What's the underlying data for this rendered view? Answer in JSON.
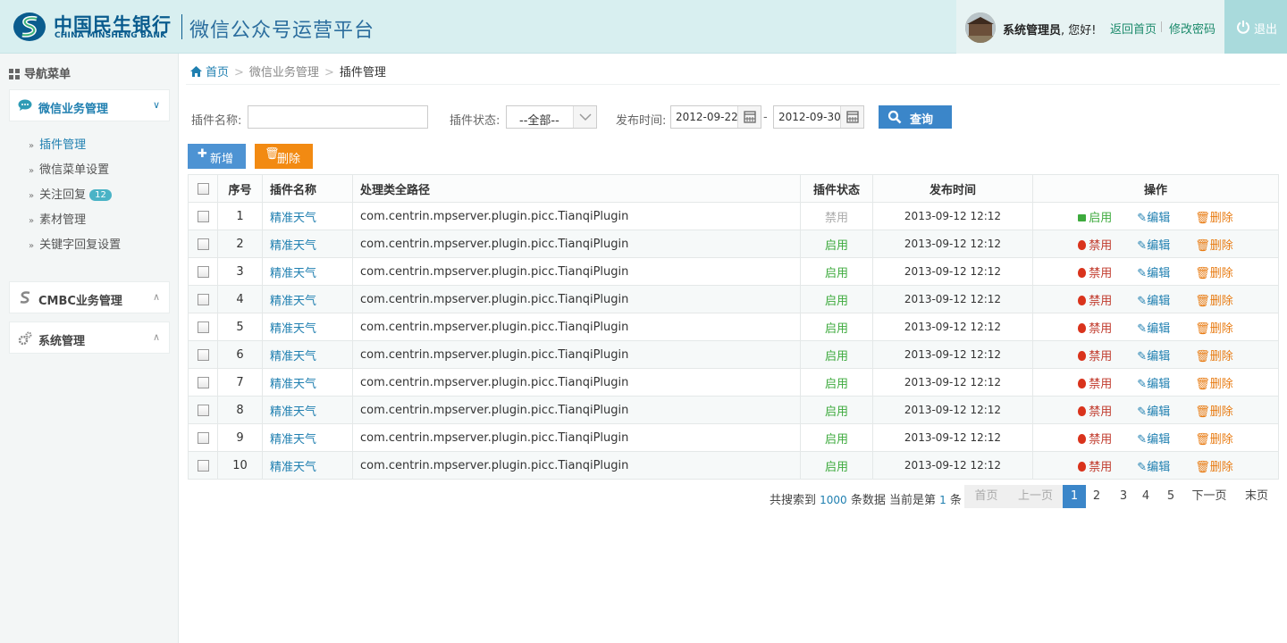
{
  "header": {
    "bank_name_cn": "中国民生银行",
    "bank_name_en": "CHINA MINSHENG BANK",
    "platform_title": "微信公众号运营平台",
    "user_role": "系统管理员",
    "greeting_suffix": ", 您好!",
    "home_link": "返回首页",
    "change_password": "修改密码",
    "logout": "退出",
    "brand_color": "#0a5c8e"
  },
  "sidebar": {
    "title": "导航菜单",
    "groups": [
      {
        "label": "微信业务管理",
        "expanded": true,
        "items": [
          {
            "label": "插件管理",
            "active": true
          },
          {
            "label": "微信菜单设置"
          },
          {
            "label": "关注回复",
            "badge": "12"
          },
          {
            "label": "素材管理"
          },
          {
            "label": "关键字回复设置"
          }
        ]
      },
      {
        "label": "CMBC业务管理",
        "expanded": false
      },
      {
        "label": "系统管理",
        "expanded": false
      }
    ]
  },
  "breadcrumb": {
    "home": "首页",
    "section": "微信业务管理",
    "current": "插件管理"
  },
  "filters": {
    "name_label": "插件名称:",
    "name_value": "",
    "status_label": "插件状态:",
    "status_value": "--全部--",
    "date_label": "发布时间:",
    "date_from": "2012-09-22",
    "date_to": "2012-09-30",
    "date_sep": "-",
    "query": "查询"
  },
  "toolbar": {
    "add": "新增",
    "delete": "删除"
  },
  "table": {
    "headers": [
      "",
      "序号",
      "插件名称",
      "处理类全路径",
      "插件状态",
      "发布时间",
      "操作"
    ],
    "rows": [
      {
        "no": "1",
        "name": "精准天气",
        "path": "com.centrin.mpserver.plugin.picc.TianqiPlugin",
        "status": "禁用",
        "time": "2013-09-12 12:12",
        "toggle": "启用"
      },
      {
        "no": "2",
        "name": "精准天气",
        "path": "com.centrin.mpserver.plugin.picc.TianqiPlugin",
        "status": "启用",
        "time": "2013-09-12 12:12",
        "toggle": "禁用"
      },
      {
        "no": "3",
        "name": "精准天气",
        "path": "com.centrin.mpserver.plugin.picc.TianqiPlugin",
        "status": "启用",
        "time": "2013-09-12 12:12",
        "toggle": "禁用"
      },
      {
        "no": "4",
        "name": "精准天气",
        "path": "com.centrin.mpserver.plugin.picc.TianqiPlugin",
        "status": "启用",
        "time": "2013-09-12 12:12",
        "toggle": "禁用"
      },
      {
        "no": "5",
        "name": "精准天气",
        "path": "com.centrin.mpserver.plugin.picc.TianqiPlugin",
        "status": "启用",
        "time": "2013-09-12 12:12",
        "toggle": "禁用"
      },
      {
        "no": "6",
        "name": "精准天气",
        "path": "com.centrin.mpserver.plugin.picc.TianqiPlugin",
        "status": "启用",
        "time": "2013-09-12 12:12",
        "toggle": "禁用"
      },
      {
        "no": "7",
        "name": "精准天气",
        "path": "com.centrin.mpserver.plugin.picc.TianqiPlugin",
        "status": "启用",
        "time": "2013-09-12 12:12",
        "toggle": "禁用"
      },
      {
        "no": "8",
        "name": "精准天气",
        "path": "com.centrin.mpserver.plugin.picc.TianqiPlugin",
        "status": "启用",
        "time": "2013-09-12 12:12",
        "toggle": "禁用"
      },
      {
        "no": "9",
        "name": "精准天气",
        "path": "com.centrin.mpserver.plugin.picc.TianqiPlugin",
        "status": "启用",
        "time": "2013-09-12 12:12",
        "toggle": "禁用"
      },
      {
        "no": "10",
        "name": "精准天气",
        "path": "com.centrin.mpserver.plugin.picc.TianqiPlugin",
        "status": "启用",
        "time": "2013-09-12 12:12",
        "toggle": "禁用"
      }
    ],
    "edit_label": "编辑",
    "delete_label": "删除"
  },
  "pager": {
    "prefix": "共搜索到",
    "total": "1000",
    "mid": "条数据 当前是第",
    "current": "1",
    "suffix": "条",
    "first": "首页",
    "prev": "上一页",
    "pages": [
      "1",
      "2",
      "3",
      "4",
      "5"
    ],
    "next": "下一页",
    "last": "末页"
  }
}
